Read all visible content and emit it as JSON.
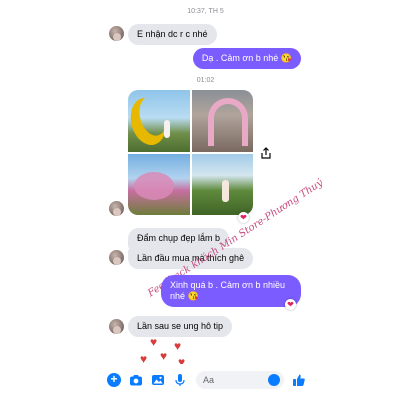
{
  "conversation": {
    "timestamp_top": "10:37, TH 5",
    "timestamp_mid": "01:02",
    "messages": [
      {
        "from": "them",
        "text": "E nhận dc r c nhé"
      },
      {
        "from": "me",
        "text": "Dạ . Cảm ơn b nhé 😘"
      },
      {
        "from": "them",
        "text": "Đẩm chụp đẹp lắm b"
      },
      {
        "from": "them",
        "text": "Lần đầu mua mà thích ghê"
      },
      {
        "from": "me",
        "text": "Xinh quá b . Cảm ơn b nhiều nhé 😘"
      },
      {
        "from": "them",
        "text": "Lần sau se ung hô tip"
      }
    ],
    "reaction": "❤"
  },
  "watermark": "Feedback khách Min Store-Phương Thuý",
  "composer": {
    "placeholder": "Aa",
    "icons": [
      "plus-icon",
      "camera-icon",
      "image-icon",
      "mic-icon",
      "emoji-icon",
      "thumbs-up-icon"
    ]
  },
  "colors": {
    "outgoing_bubble": "#7b5cff",
    "incoming_bubble": "#e4e6eb",
    "accent": "#0a7cff"
  }
}
